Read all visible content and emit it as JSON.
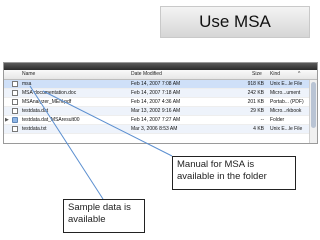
{
  "slide": {
    "title": "Use MSA"
  },
  "finder": {
    "columns": {
      "name": "Name",
      "date": "Date Modified",
      "size": "Size",
      "kind": "Kind",
      "sort_mark": "^"
    },
    "rows": [
      {
        "name": "msa",
        "date": "Feb 14, 2007 7:08 AM",
        "size": "918 KB",
        "kind": "Unix E...le File",
        "icon": "file-icon",
        "selected": true
      },
      {
        "name": "MSA documentation.doc",
        "date": "Feb 14, 2007 7:18 AM",
        "size": "242 KB",
        "kind": "Micro...ument",
        "icon": "file-icon"
      },
      {
        "name": "MSAnalyzer_MEN.pdf",
        "date": "Feb 14, 2007 4:36 AM",
        "size": "201 KB",
        "kind": "Portab... (PDF)",
        "icon": "file-icon"
      },
      {
        "name": "testdata.dat",
        "date": "Mar 13, 2002 9:16 AM",
        "size": "29 KB",
        "kind": "Micro...rkbook",
        "icon": "file-icon"
      },
      {
        "name": "testdata.dat_MSAresult00",
        "date": "Feb 14, 2007 7:27 AM",
        "size": "--",
        "kind": "Folder",
        "icon": "folder-icon",
        "disclosure": "▶"
      },
      {
        "name": "testdata.txt",
        "date": "Mar 3, 2006 8:53 AM",
        "size": "4 KB",
        "kind": "Unix E...le File",
        "icon": "file-icon"
      }
    ]
  },
  "callouts": {
    "manual": "Manual for MSA is available in the folder",
    "sample": "Sample data is available"
  }
}
